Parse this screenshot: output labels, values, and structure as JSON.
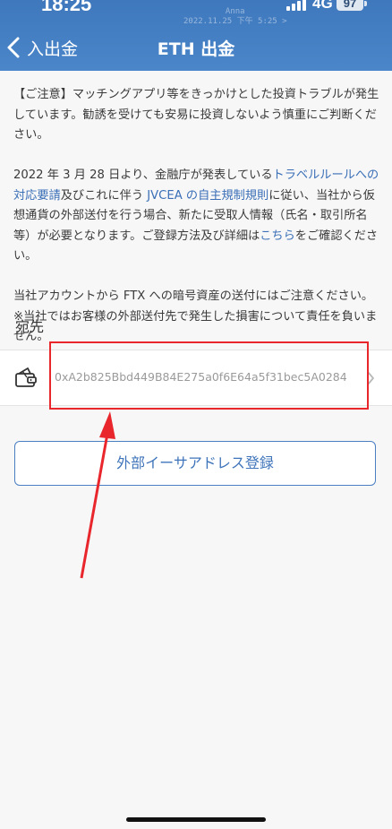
{
  "status_bar": {
    "time": "18:25",
    "watermark_name": "Anna",
    "watermark_datetime": "2022.11.25 下午 5:25 >",
    "network": "4G",
    "battery": "97"
  },
  "header": {
    "back_label": "入出金",
    "title": "ETH 出金"
  },
  "notice": {
    "caution": "【ご注意】マッチングアプリ等をきっかけとした投資トラブルが発生しています。勧誘を受けても安易に投資しないよう慎重にご判断ください。",
    "travel_rule_p1": "2022 年 3 月 28 日より、金融庁が発表している",
    "travel_rule_link1": "トラベルルールへの対応要請",
    "travel_rule_p2": "及びこれに伴う ",
    "travel_rule_link2": "JVCEA の自主規制規則",
    "travel_rule_p3": "に従い、当社から仮想通貨の外部送付を行う場合、新たに受取人情報（氏名・取引所名等）が必要となります。ご登録方法及び詳細は",
    "travel_rule_link3": "こちら",
    "travel_rule_p4": "をご確認ください。",
    "ftx_warning_1": "当社アカウントから FTX への暗号資産の送付にはご注意ください。",
    "ftx_warning_2": "※当社ではお客様の外部送付先で発生した損害について責任を負いません。"
  },
  "destination": {
    "label": "宛先",
    "address": "0xA2b825Bbd449B84E275a0f6E64a5f31bec5A0284"
  },
  "actions": {
    "register_external_address": "外部イーサアドレス登録"
  },
  "colors": {
    "header": "#4a86c9",
    "link": "#3a6fb7",
    "annotation": "#e8262c"
  }
}
